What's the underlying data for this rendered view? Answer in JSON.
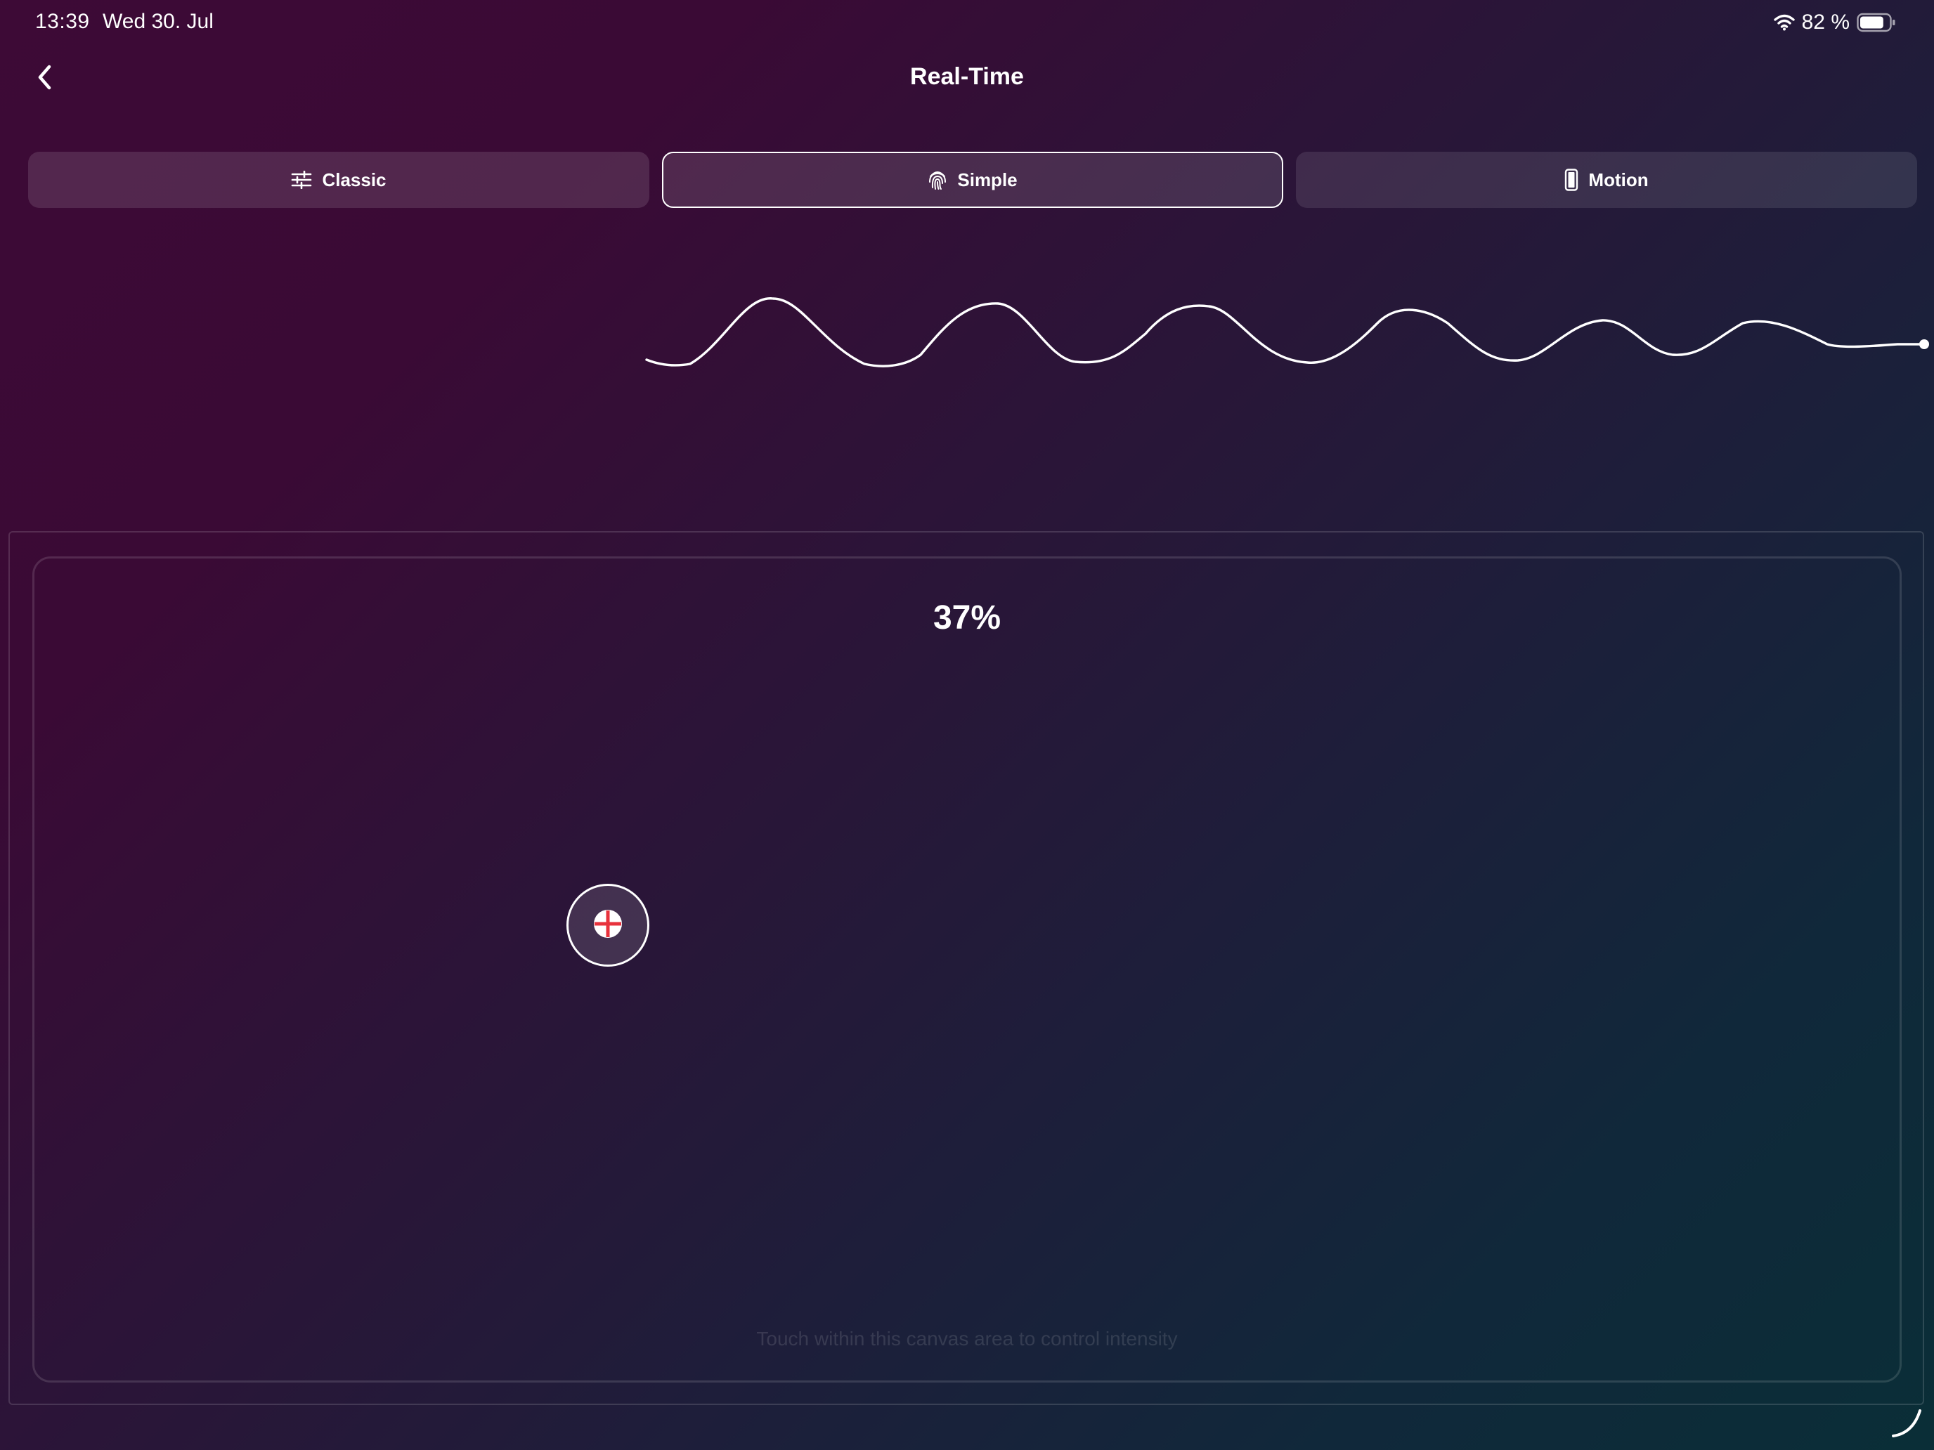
{
  "status_bar": {
    "time": "13:39",
    "date": "Wed 30. Jul",
    "battery_percent": "82 %",
    "battery_level": 0.82,
    "icons": [
      "wifi-icon",
      "battery-icon"
    ]
  },
  "header": {
    "title": "Real-Time",
    "back_icon": "chevron-left-icon"
  },
  "mode_tabs": [
    {
      "label": "Classic",
      "icon": "sliders-icon",
      "selected": false
    },
    {
      "label": "Simple",
      "icon": "fingerprint-icon",
      "selected": true
    },
    {
      "label": "Motion",
      "icon": "phone-icon",
      "selected": false
    }
  ],
  "canvas": {
    "intensity": "37%",
    "intensity_value": 0.37,
    "hint": "Touch within this canvas area to control intensity",
    "handle_icon": "crosshair-icon"
  },
  "colors": {
    "background_start": "#3d0a36",
    "background_end": "#0a2e37",
    "accent": "#ffffff",
    "handle_center": "#e8323c"
  }
}
